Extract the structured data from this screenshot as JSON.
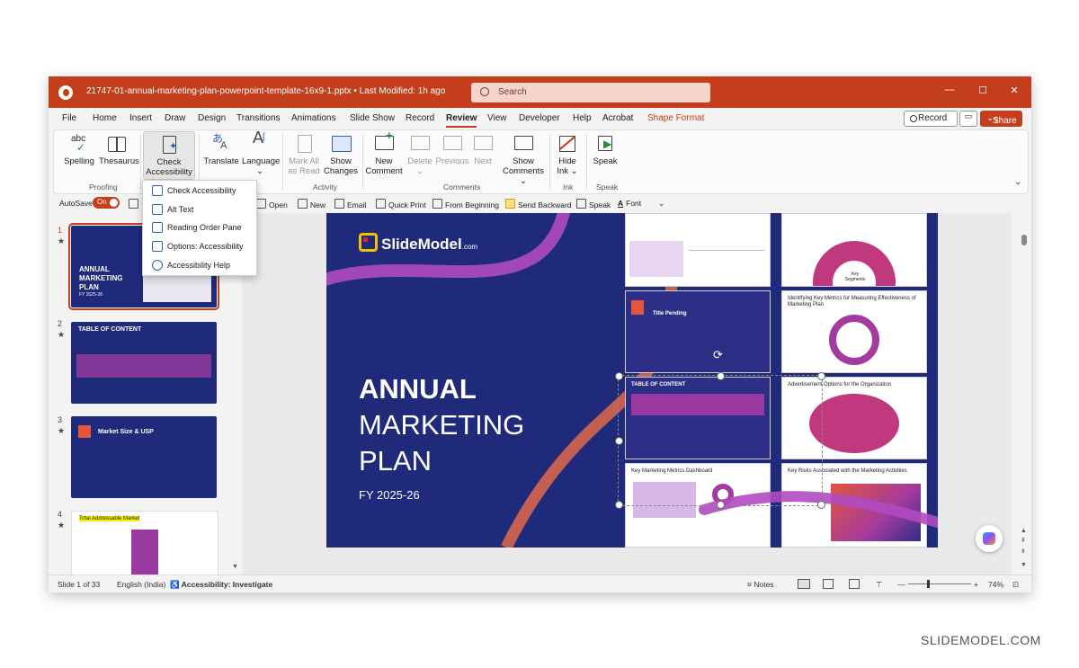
{
  "window": {
    "doc_title": "21747-01-annual-marketing-plan-powerpoint-template-16x9-1.pptx • Last Modified: 1h ago",
    "search_placeholder": "Search",
    "minimize": "—",
    "maximize": "☐",
    "close": "✕"
  },
  "menu": {
    "tabs": [
      "File",
      "Home",
      "Insert",
      "Draw",
      "Design",
      "Transitions",
      "Animations",
      "Slide Show",
      "Record",
      "Review",
      "View",
      "Developer",
      "Help",
      "Acrobat",
      "Shape Format"
    ],
    "active": "Review",
    "record_label": "Record",
    "share_label": "Share"
  },
  "ribbon": {
    "spelling": "Spelling",
    "thesaurus": "Thesaurus",
    "check_access_1": "Check",
    "check_access_2": "Accessibility",
    "translate": "Translate",
    "language": "Language",
    "mark_all_1": "Mark All",
    "mark_all_2": "as Read",
    "show_changes_1": "Show",
    "show_changes_2": "Changes",
    "new_comment_1": "New",
    "new_comment_2": "Comment",
    "delete": "Delete",
    "previous": "Previous",
    "next": "Next",
    "show_comments_1": "Show",
    "show_comments_2": "Comments",
    "hide_ink_1": "Hide",
    "hide_ink_2": "Ink",
    "speak": "Speak",
    "groups": {
      "proofing": "Proofing",
      "activity": "Activity",
      "comments": "Comments",
      "ink": "Ink",
      "speak": "Speak"
    }
  },
  "qat": {
    "autosave": "AutoSave",
    "toggle": "On",
    "items": [
      "Open",
      "New",
      "Email",
      "Quick Print",
      "From Beginning",
      "Send Backward",
      "Speak",
      "Font"
    ]
  },
  "dropdown": {
    "items": [
      "Check Accessibility",
      "Alt Text",
      "Reading Order Pane",
      "Options: Accessibility",
      "Accessibility Help"
    ]
  },
  "thumbnails": [
    {
      "num": "1",
      "star": "★",
      "title": "ANNUAL MARKETING PLAN",
      "sub": "FY 2025-26"
    },
    {
      "num": "2",
      "star": "★",
      "title": "TABLE OF CONTENT",
      "sub": ""
    },
    {
      "num": "3",
      "star": "★",
      "title": "Market Size & USP",
      "sub": ""
    },
    {
      "num": "4",
      "star": "★",
      "title": "Total Addressable Market",
      "sub": ""
    }
  ],
  "slide": {
    "brand": "SlideModel",
    "brand_suffix": ".com",
    "line1": "ANNUAL",
    "line2": "MARKETING",
    "line3": "PLAN",
    "fy": "FY 2025-26",
    "cards": {
      "title_pending": "Title Pending",
      "key_metrics": "Identifying Key Metrics for Measuring Effectiveness of Marketing Plan",
      "advertisement": "Advertisement Options for the Organization",
      "table_content": "TABLE OF CONTENT",
      "dashboard": "Key Marketing Metrics Dashboard",
      "key_risks": "Key Risks Associated with the Marketing Activities",
      "key_segments": "Key Segments"
    }
  },
  "status": {
    "slide_of": "Slide 1 of 33",
    "language": "English (India)",
    "accessibility": "Accessibility: Investigate",
    "notes": "Notes",
    "zoom": "74%"
  },
  "watermark": "SLIDEMODEL.COM",
  "colors": {
    "accent": "#c43e1c",
    "slide_bg": "#1f2a7a"
  }
}
